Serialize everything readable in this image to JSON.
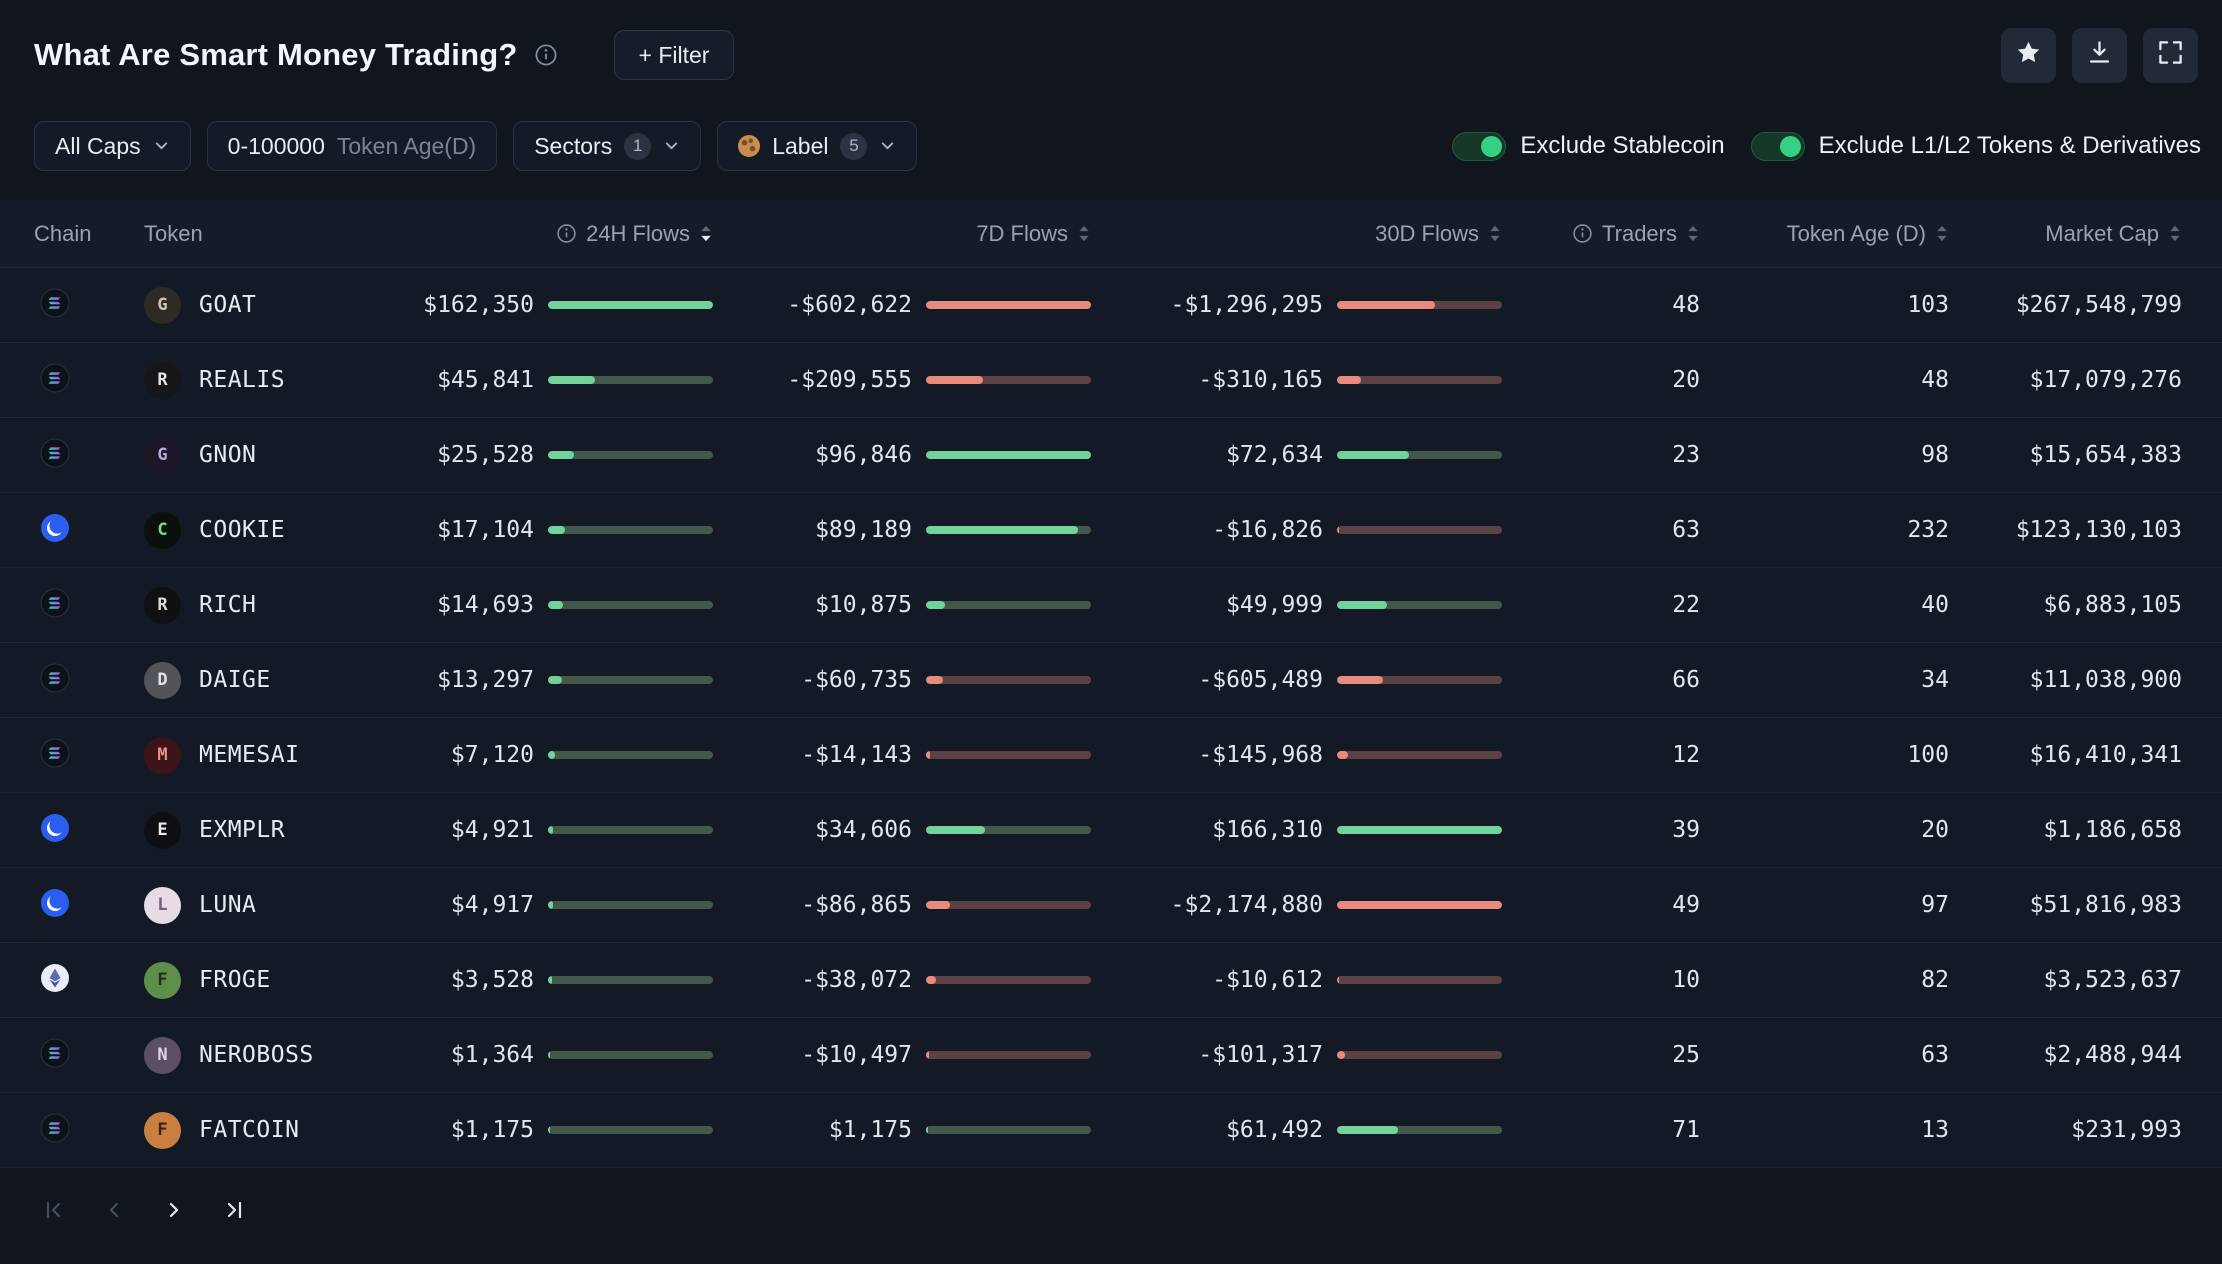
{
  "header": {
    "title": "What Are Smart Money Trading?",
    "filter_button": "+ Filter"
  },
  "icons": {
    "title_info": "info-circle",
    "actions": [
      "star",
      "download",
      "fullscreen"
    ],
    "label_chip_icon": "cookie"
  },
  "filters": {
    "market_cap": {
      "label": "All Caps"
    },
    "token_age": {
      "value": "0-100000",
      "label": "Token Age(D)"
    },
    "sectors": {
      "label": "Sectors",
      "count": "1"
    },
    "label": {
      "icon": "cookie",
      "label": "Label",
      "count": "5"
    },
    "toggles": [
      {
        "label": "Exclude Stablecoin",
        "on": true
      },
      {
        "label": "Exclude L1/L2 Tokens & Derivatives",
        "on": true
      }
    ]
  },
  "table": {
    "columns": [
      {
        "label": "Chain"
      },
      {
        "label": "Token"
      },
      {
        "label": "24H Flows",
        "info": true,
        "sortable": true,
        "sorted": "desc"
      },
      {
        "label": "7D Flows",
        "sortable": true
      },
      {
        "label": "30D Flows",
        "sortable": true
      },
      {
        "label": "Traders",
        "info": true,
        "sortable": true
      },
      {
        "label": "Token Age (D)",
        "sortable": true
      },
      {
        "label": "Market Cap",
        "sortable": true
      }
    ],
    "rows": [
      {
        "chain": "solana",
        "token": "GOAT",
        "avatar": {
          "bg": "#2e2a26",
          "fg": "#cfc5b8",
          "text": "G"
        },
        "flows_24h": {
          "text": "$162,350",
          "value": 162350
        },
        "flows_7d": {
          "text": "-$602,622",
          "value": -602622
        },
        "flows_30d": {
          "text": "-$1,296,295",
          "value": -1296295
        },
        "traders": "48",
        "token_age": "103",
        "market_cap": "$267,548,799"
      },
      {
        "chain": "solana",
        "token": "REALIS",
        "avatar": {
          "bg": "#16161a",
          "fg": "#e6e6e6",
          "text": "R"
        },
        "flows_24h": {
          "text": "$45,841",
          "value": 45841
        },
        "flows_7d": {
          "text": "-$209,555",
          "value": -209555
        },
        "flows_30d": {
          "text": "-$310,165",
          "value": -310165
        },
        "traders": "20",
        "token_age": "48",
        "market_cap": "$17,079,276"
      },
      {
        "chain": "solana",
        "token": "GNON",
        "avatar": {
          "bg": "#1c1627",
          "fg": "#b9a8d8",
          "text": "G"
        },
        "flows_24h": {
          "text": "$25,528",
          "value": 25528
        },
        "flows_7d": {
          "text": "$96,846",
          "value": 96846
        },
        "flows_30d": {
          "text": "$72,634",
          "value": 72634
        },
        "traders": "23",
        "token_age": "98",
        "market_cap": "$15,654,383"
      },
      {
        "chain": "base",
        "token": "COOKIE",
        "avatar": {
          "bg": "#0c100d",
          "fg": "#6fe08a",
          "text": "C"
        },
        "flows_24h": {
          "text": "$17,104",
          "value": 17104
        },
        "flows_7d": {
          "text": "$89,189",
          "value": 89189
        },
        "flows_30d": {
          "text": "-$16,826",
          "value": -16826
        },
        "traders": "63",
        "token_age": "232",
        "market_cap": "$123,130,103"
      },
      {
        "chain": "solana",
        "token": "RICH",
        "avatar": {
          "bg": "#101013",
          "fg": "#dcdcdc",
          "text": "R"
        },
        "flows_24h": {
          "text": "$14,693",
          "value": 14693
        },
        "flows_7d": {
          "text": "$10,875",
          "value": 10875
        },
        "flows_30d": {
          "text": "$49,999",
          "value": 49999
        },
        "traders": "22",
        "token_age": "40",
        "market_cap": "$6,883,105"
      },
      {
        "chain": "solana",
        "token": "DAIGE",
        "avatar": {
          "bg": "#53535a",
          "fg": "#e2e2e6",
          "text": "D"
        },
        "flows_24h": {
          "text": "$13,297",
          "value": 13297
        },
        "flows_7d": {
          "text": "-$60,735",
          "value": -60735
        },
        "flows_30d": {
          "text": "-$605,489",
          "value": -605489
        },
        "traders": "66",
        "token_age": "34",
        "market_cap": "$11,038,900"
      },
      {
        "chain": "solana",
        "token": "MEMESAI",
        "avatar": {
          "bg": "#3c1317",
          "fg": "#e98f8f",
          "text": "M"
        },
        "flows_24h": {
          "text": "$7,120",
          "value": 7120
        },
        "flows_7d": {
          "text": "-$14,143",
          "value": -14143
        },
        "flows_30d": {
          "text": "-$145,968",
          "value": -145968
        },
        "traders": "12",
        "token_age": "100",
        "market_cap": "$16,410,341"
      },
      {
        "chain": "base",
        "token": "EXMPLR",
        "avatar": {
          "bg": "#0e0e13",
          "fg": "#ececec",
          "text": "E"
        },
        "flows_24h": {
          "text": "$4,921",
          "value": 4921
        },
        "flows_7d": {
          "text": "$34,606",
          "value": 34606
        },
        "flows_30d": {
          "text": "$166,310",
          "value": 166310
        },
        "traders": "39",
        "token_age": "20",
        "market_cap": "$1,186,658"
      },
      {
        "chain": "base",
        "token": "LUNA",
        "avatar": {
          "bg": "#e7dce6",
          "fg": "#7a5a74",
          "text": "L"
        },
        "flows_24h": {
          "text": "$4,917",
          "value": 4917
        },
        "flows_7d": {
          "text": "-$86,865",
          "value": -86865
        },
        "flows_30d": {
          "text": "-$2,174,880",
          "value": -2174880
        },
        "traders": "49",
        "token_age": "97",
        "market_cap": "$51,816,983"
      },
      {
        "chain": "ethereum",
        "token": "FROGE",
        "avatar": {
          "bg": "#5d8f4a",
          "fg": "#1e3314",
          "text": "F"
        },
        "flows_24h": {
          "text": "$3,528",
          "value": 3528
        },
        "flows_7d": {
          "text": "-$38,072",
          "value": -38072
        },
        "flows_30d": {
          "text": "-$10,612",
          "value": -10612
        },
        "traders": "10",
        "token_age": "82",
        "market_cap": "$3,523,637"
      },
      {
        "chain": "solana",
        "token": "NEROBOSS",
        "avatar": {
          "bg": "#5a4f63",
          "fg": "#ddd6e6",
          "text": "N"
        },
        "flows_24h": {
          "text": "$1,364",
          "value": 1364
        },
        "flows_7d": {
          "text": "-$10,497",
          "value": -10497
        },
        "flows_30d": {
          "text": "-$101,317",
          "value": -101317
        },
        "traders": "25",
        "token_age": "63",
        "market_cap": "$2,488,944"
      },
      {
        "chain": "solana",
        "token": "FATCOIN",
        "avatar": {
          "bg": "#c97f3f",
          "fg": "#3a2410",
          "text": "F"
        },
        "flows_24h": {
          "text": "$1,175",
          "value": 1175
        },
        "flows_7d": {
          "text": "$1,175",
          "value": 1175
        },
        "flows_30d": {
          "text": "$61,492",
          "value": 61492
        },
        "traders": "71",
        "token_age": "13",
        "market_cap": "$231,993"
      }
    ]
  },
  "pagination": {
    "first": {
      "enabled": false
    },
    "prev": {
      "enabled": false
    },
    "next": {
      "enabled": true
    },
    "last": {
      "enabled": true
    }
  },
  "colors": {
    "positive": "#72d39a",
    "positive_track": "#43584b",
    "negative": "#e78b7e",
    "negative_track": "#5c4145",
    "toggle": "#34d184",
    "base_chain_blue": "#2b5df0"
  }
}
